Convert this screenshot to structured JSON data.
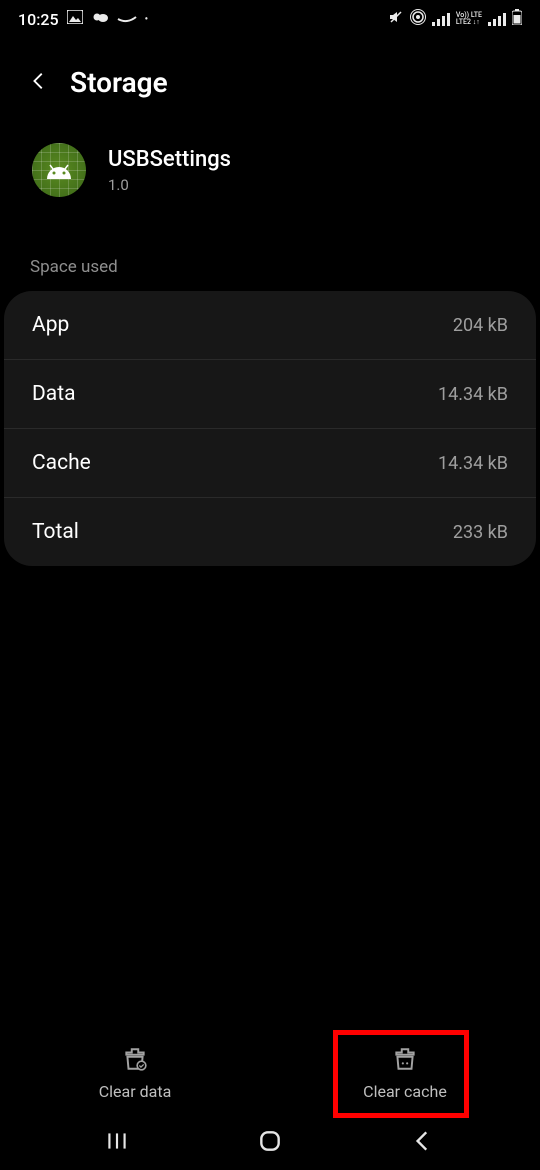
{
  "status": {
    "time": "10:25",
    "lte_text": "LTE",
    "lte2_text": "LTE2",
    "volte_text": "Vo))"
  },
  "header": {
    "title": "Storage"
  },
  "app": {
    "name": "USBSettings",
    "version": "1.0"
  },
  "section_label": "Space used",
  "rows": [
    {
      "label": "App",
      "value": "204 kB"
    },
    {
      "label": "Data",
      "value": "14.34 kB"
    },
    {
      "label": "Cache",
      "value": "14.34 kB"
    },
    {
      "label": "Total",
      "value": "233 kB"
    }
  ],
  "actions": {
    "clear_data": "Clear data",
    "clear_cache": "Clear cache"
  }
}
